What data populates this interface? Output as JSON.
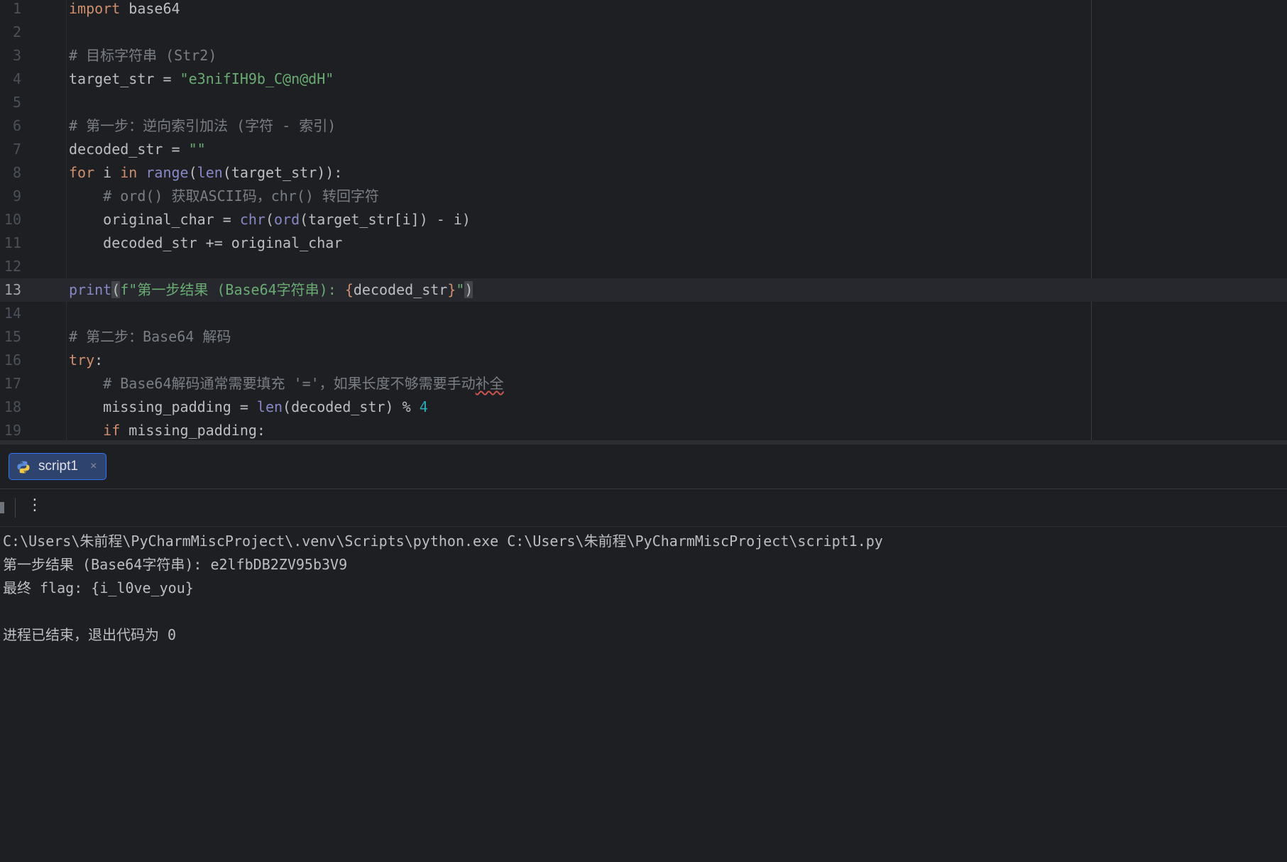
{
  "editor": {
    "active_line": 13,
    "lines": [
      {
        "n": "1",
        "tokens": [
          {
            "t": "import",
            "c": "kw"
          },
          {
            "t": " base64",
            "c": ""
          }
        ]
      },
      {
        "n": "2",
        "tokens": []
      },
      {
        "n": "3",
        "tokens": [
          {
            "t": "# 目标字符串 (Str2)",
            "c": "cm"
          }
        ]
      },
      {
        "n": "4",
        "tokens": [
          {
            "t": "target_str = ",
            "c": ""
          },
          {
            "t": "\"e3nifIH9b_C@n@dH\"",
            "c": "str"
          }
        ]
      },
      {
        "n": "5",
        "tokens": []
      },
      {
        "n": "6",
        "tokens": [
          {
            "t": "# 第一步：逆向索引加法 (字符 - 索引)",
            "c": "cm"
          }
        ]
      },
      {
        "n": "7",
        "tokens": [
          {
            "t": "decoded_str = ",
            "c": ""
          },
          {
            "t": "\"\"",
            "c": "str"
          }
        ]
      },
      {
        "n": "8",
        "tokens": [
          {
            "t": "for",
            "c": "kw"
          },
          {
            "t": " i ",
            "c": ""
          },
          {
            "t": "in",
            "c": "kw"
          },
          {
            "t": " ",
            "c": ""
          },
          {
            "t": "range",
            "c": "fn"
          },
          {
            "t": "(",
            "c": ""
          },
          {
            "t": "len",
            "c": "fn"
          },
          {
            "t": "(target_str)):",
            "c": ""
          }
        ]
      },
      {
        "n": "9",
        "tokens": [
          {
            "t": "    # ord() 获取ASCII码，chr() 转回字符",
            "c": "cm"
          }
        ]
      },
      {
        "n": "10",
        "tokens": [
          {
            "t": "    original_char = ",
            "c": ""
          },
          {
            "t": "chr",
            "c": "fn"
          },
          {
            "t": "(",
            "c": ""
          },
          {
            "t": "ord",
            "c": "fn"
          },
          {
            "t": "(target_str[i]) - i)",
            "c": ""
          }
        ]
      },
      {
        "n": "11",
        "tokens": [
          {
            "t": "    decoded_str += original_char",
            "c": ""
          }
        ]
      },
      {
        "n": "12",
        "tokens": []
      },
      {
        "n": "13",
        "tokens": [
          {
            "t": "print",
            "c": "fn"
          },
          {
            "t": "(",
            "c": "brm"
          },
          {
            "t": "f\"第一步结果 (Base64字符串): ",
            "c": "str"
          },
          {
            "t": "{",
            "c": "kw"
          },
          {
            "t": "decoded_str",
            "c": ""
          },
          {
            "t": "}",
            "c": "kw"
          },
          {
            "t": "\"",
            "c": "str"
          },
          {
            "t": ")",
            "c": "brm"
          }
        ]
      },
      {
        "n": "14",
        "tokens": []
      },
      {
        "n": "15",
        "tokens": [
          {
            "t": "# 第二步：Base64 解码",
            "c": "cm"
          }
        ]
      },
      {
        "n": "16",
        "tokens": [
          {
            "t": "try",
            "c": "kw"
          },
          {
            "t": ":",
            "c": ""
          }
        ]
      },
      {
        "n": "17",
        "tokens": [
          {
            "t": "    # Base64解码通常需要填充 '='，如果长度不够需要手动",
            "c": "cm"
          },
          {
            "t": "补全",
            "c": "cm squig"
          }
        ]
      },
      {
        "n": "18",
        "tokens": [
          {
            "t": "    missing_padding = ",
            "c": ""
          },
          {
            "t": "len",
            "c": "fn"
          },
          {
            "t": "(decoded_str) % ",
            "c": ""
          },
          {
            "t": "4",
            "c": "num"
          }
        ]
      },
      {
        "n": "19",
        "tokens": [
          {
            "t": "    ",
            "c": ""
          },
          {
            "t": "if",
            "c": "kw"
          },
          {
            "t": " missing_padding:",
            "c": ""
          }
        ]
      }
    ]
  },
  "run": {
    "tab_label": "script1",
    "tab_icon": "python-icon",
    "close_glyph": "×",
    "more_glyph": "⋮",
    "console_lines": [
      "C:\\Users\\朱前程\\PyCharmMiscProject\\.venv\\Scripts\\python.exe C:\\Users\\朱前程\\PyCharmMiscProject\\script1.py",
      "第一步结果 (Base64字符串): e2lfbDB2ZV95b3V9",
      "最终 flag: {i_l0ve_you}",
      "",
      "进程已结束，退出代码为 0"
    ]
  },
  "colors": {
    "background": "#1e1f22",
    "keyword": "#cf8e6d",
    "string": "#6aab73",
    "comment": "#7a7e85",
    "builtin": "#8888c6",
    "number": "#2aacb8",
    "tab_accent": "#3574f0"
  }
}
